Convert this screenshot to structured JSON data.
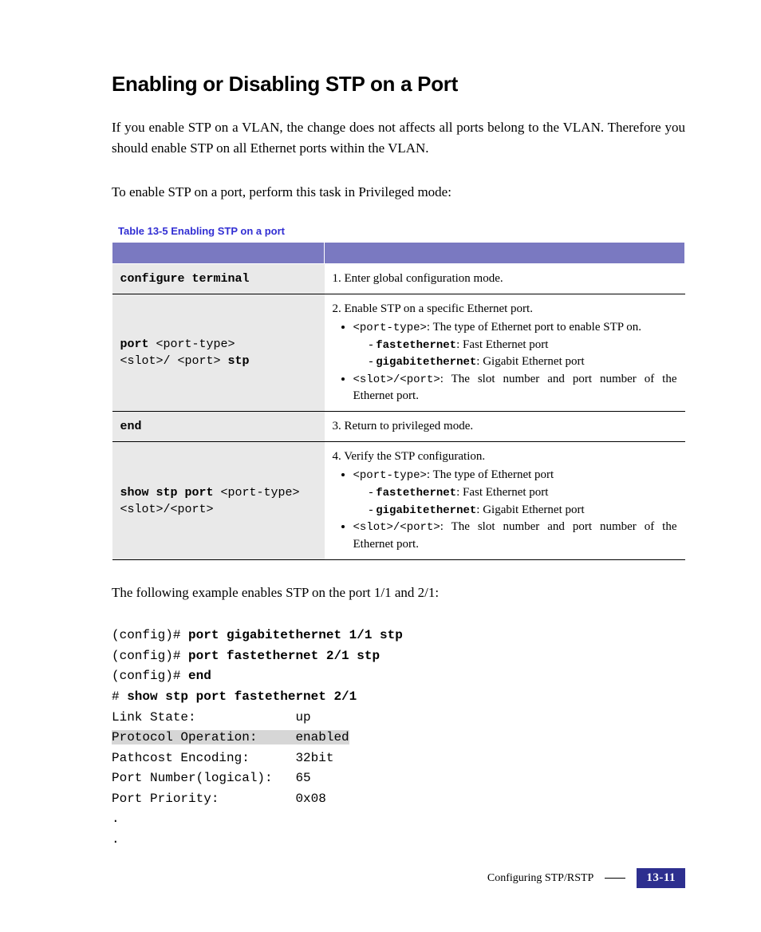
{
  "heading": "Enabling or Disabling STP on a Port",
  "intro": "If you enable STP on a VLAN, the change does not affects all ports belong to the VLAN. Therefore you should enable STP on all Ethernet ports within the VLAN.",
  "lead": "To enable STP on a port, perform this task in Privileged mode:",
  "table_caption": "Table 13-5   Enabling STP on a port",
  "rows": {
    "r1": {
      "cmd": "configure terminal",
      "desc": "1. Enter global configuration mode."
    },
    "r2": {
      "cmd_line1_a": "port ",
      "cmd_line1_b": "<port-type>",
      "cmd_line2_a": "<slot>/ <port> ",
      "cmd_line2_b": "stp",
      "d_head": "2. Enable STP on a specific Ethernet port.",
      "b1a": "<port-type>",
      "b1b": ": The type of Ethernet port to enable STP on.",
      "s1a": "fastethernet",
      "s1b": ": Fast Ethernet port",
      "s2a": "gigabitethernet",
      "s2b": ": Gigabit Ethernet port",
      "b2a": "<slot>/<port>",
      "b2b": ": The slot number and port number of the Ethernet port."
    },
    "r3": {
      "cmd": "end",
      "desc": "3. Return to privileged mode."
    },
    "r4": {
      "cmd_line1_a": "show stp port ",
      "cmd_line1_b": "<port-type>",
      "cmd_line2": "<slot>/<port>",
      "d_head": "4. Verify the STP configuration.",
      "b1a": "<port-type>",
      "b1b": ": The type of Ethernet port",
      "s1a": "fastethernet",
      "s1b": ": Fast Ethernet port",
      "s2a": "gigabitethernet",
      "s2b": ": Gigabit Ethernet port",
      "b2a": "<slot>/<port>",
      "b2b": ": The slot number and port number of the Ethernet port."
    }
  },
  "example_lead": "The following example enables STP on the port 1/1 and 2/1:",
  "code": {
    "l1a": "(config)# ",
    "l1b": "port gigabitethernet 1/1 stp",
    "l2a": "(config)# ",
    "l2b": "port fastethernet 2/1 stp",
    "l3a": "(config)# ",
    "l3b": "end",
    "l4a": "# ",
    "l4b": "show stp port fastethernet 2/1",
    "l5": "Link State:             up",
    "l6": "Protocol Operation:     enabled",
    "l7": "Pathcost Encoding:      32bit",
    "l8": "Port Number(logical):   65",
    "l9": "Port Priority:          0x08",
    "l10": ".",
    "l11": "."
  },
  "footer_text": "Configuring STP/RSTP",
  "page_num": "13-11"
}
